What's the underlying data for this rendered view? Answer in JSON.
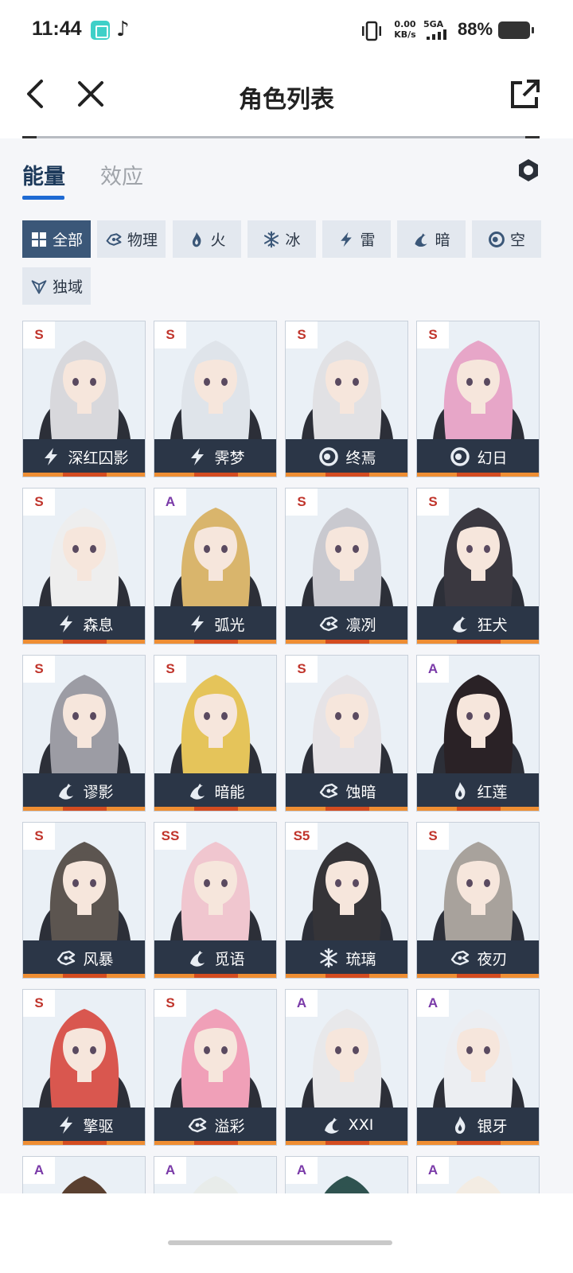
{
  "status_bar": {
    "time": "11:44",
    "net_speed_value": "0.00",
    "net_speed_unit": "KB/s",
    "network": "5GA",
    "battery": "88%"
  },
  "nav": {
    "title": "角色列表"
  },
  "tabs": [
    {
      "label": "能量",
      "active": true
    },
    {
      "label": "效应",
      "active": false
    }
  ],
  "filters": [
    {
      "label": "全部",
      "icon": "grid-icon",
      "active": true
    },
    {
      "label": "物理",
      "icon": "physical-icon",
      "active": false
    },
    {
      "label": "火",
      "icon": "fire-icon",
      "active": false
    },
    {
      "label": "冰",
      "icon": "ice-icon",
      "active": false
    },
    {
      "label": "雷",
      "icon": "lightning-icon",
      "active": false
    },
    {
      "label": "暗",
      "icon": "dark-icon",
      "active": false
    },
    {
      "label": "空",
      "icon": "void-icon",
      "active": false
    },
    {
      "label": "独域",
      "icon": "domain-icon",
      "active": false
    }
  ],
  "characters": [
    {
      "rank": "S",
      "name": "深红囚影",
      "element": "lightning-icon",
      "hair": "#d8d8dc"
    },
    {
      "rank": "S",
      "name": "霁梦",
      "element": "lightning-icon",
      "hair": "#dfe4ea"
    },
    {
      "rank": "S",
      "name": "终焉",
      "element": "void-icon",
      "hair": "#e1e1e4"
    },
    {
      "rank": "S",
      "name": "幻日",
      "element": "void-icon",
      "hair": "#e7a6c8"
    },
    {
      "rank": "S",
      "name": "森息",
      "element": "lightning-icon",
      "hair": "#eeeeee"
    },
    {
      "rank": "A",
      "name": "弧光",
      "element": "lightning-icon",
      "hair": "#d9b56c"
    },
    {
      "rank": "S",
      "name": "凛冽",
      "element": "physical-icon",
      "hair": "#c9c9cf"
    },
    {
      "rank": "S",
      "name": "狂犬",
      "element": "dark-icon",
      "hair": "#3a3840"
    },
    {
      "rank": "S",
      "name": "谬影",
      "element": "dark-icon",
      "hair": "#9c9ca4"
    },
    {
      "rank": "S",
      "name": "暗能",
      "element": "dark-icon",
      "hair": "#e5c45a"
    },
    {
      "rank": "S",
      "name": "蚀暗",
      "element": "physical-icon",
      "hair": "#e6e3e6"
    },
    {
      "rank": "A",
      "name": "红莲",
      "element": "fire-icon",
      "hair": "#2a2226"
    },
    {
      "rank": "S",
      "name": "风暴",
      "element": "physical-icon",
      "hair": "#5c5550"
    },
    {
      "rank": "SS",
      "name": "觅语",
      "element": "dark-icon",
      "hair": "#f0c6cf"
    },
    {
      "rank": "S5",
      "name": "琉璃",
      "element": "ice-icon",
      "hair": "#353438"
    },
    {
      "rank": "S",
      "name": "夜刃",
      "element": "physical-icon",
      "hair": "#a8a29c"
    },
    {
      "rank": "S",
      "name": "擎驱",
      "element": "lightning-icon",
      "hair": "#d9574f"
    },
    {
      "rank": "S",
      "name": "溢彩",
      "element": "physical-icon",
      "hair": "#f0a0b8"
    },
    {
      "rank": "A",
      "name": "XXI",
      "element": "dark-icon",
      "hair": "#e8e8ea"
    },
    {
      "rank": "A",
      "name": "银牙",
      "element": "fire-icon",
      "hair": "#eceef2"
    },
    {
      "rank": "A",
      "name": "",
      "element": "",
      "hair": "#5a4030"
    },
    {
      "rank": "A",
      "name": "",
      "element": "",
      "hair": "#e8ecea"
    },
    {
      "rank": "A",
      "name": "",
      "element": "",
      "hair": "#2f5350"
    },
    {
      "rank": "A",
      "name": "",
      "element": "",
      "hair": "#f3ece3"
    }
  ]
}
